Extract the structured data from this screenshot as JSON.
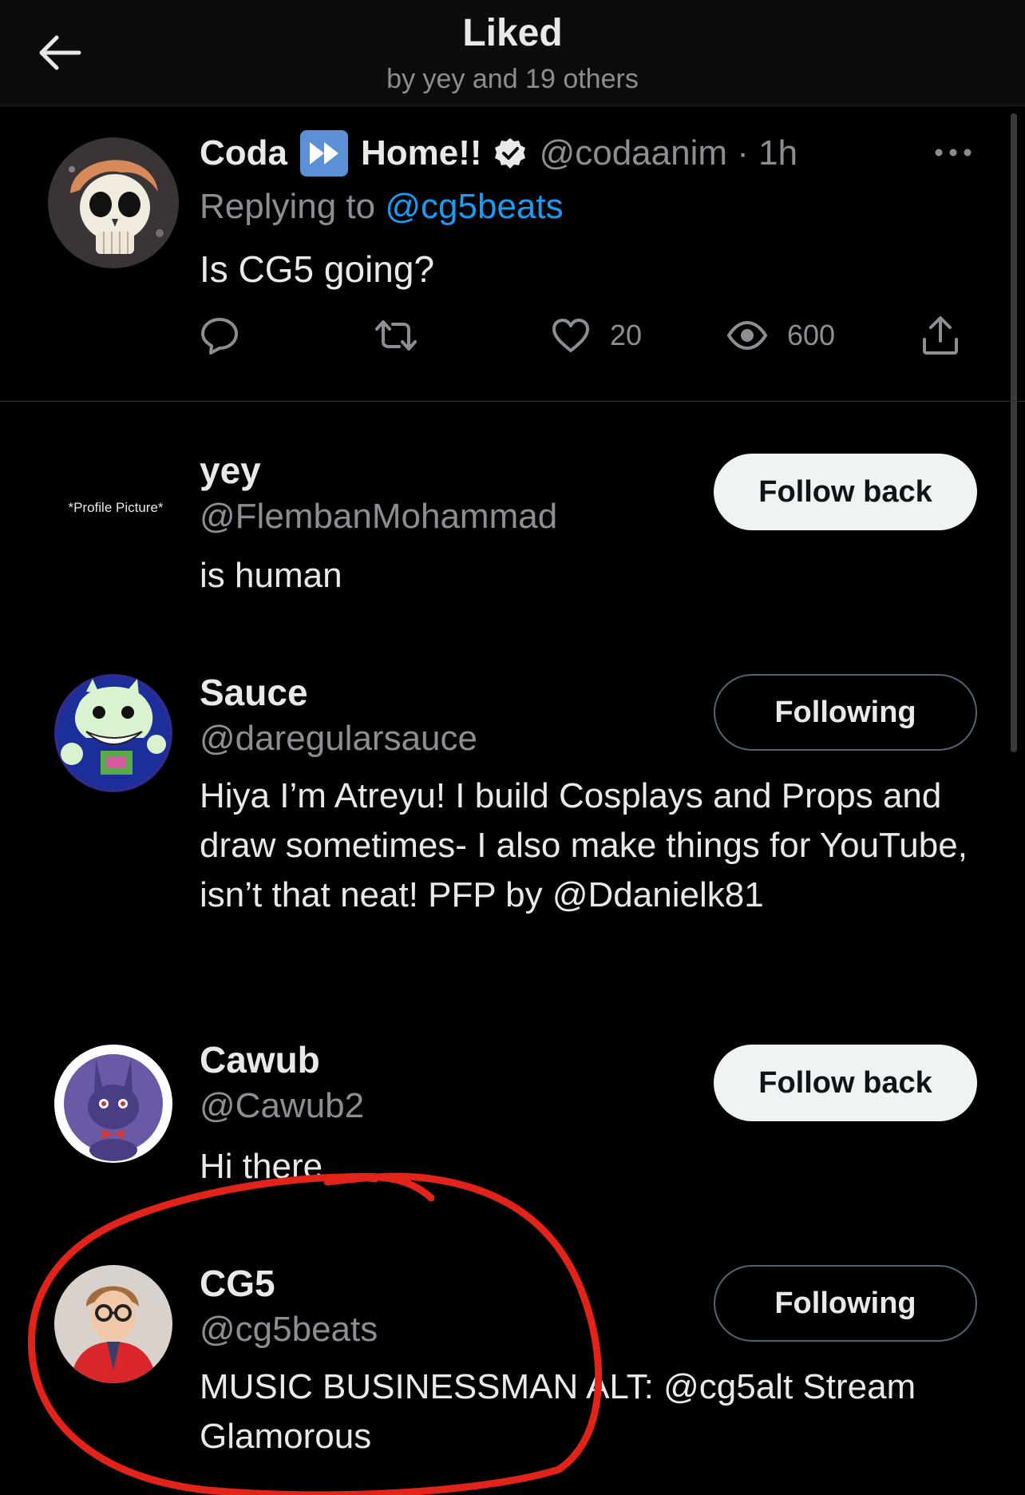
{
  "header": {
    "title": "Liked",
    "subtitle": "by yey and 19 others"
  },
  "tweet": {
    "name_part1": "Coda",
    "name_part2": "Home!!",
    "handle_time": "@codaanim · 1h",
    "replying_prefix": "Replying to",
    "replying_handle": "@cg5beats",
    "text": "Is CG5 going?",
    "likes": "20",
    "views": "600"
  },
  "users": [
    {
      "name": "yey",
      "handle": "@FlembanMohammad",
      "bio": "is human",
      "button": "Follow back",
      "avatar_text": "*Profile Picture*"
    },
    {
      "name": "Sauce",
      "handle": "@daregularsauce",
      "bio": "Hiya I’m Atreyu! I build Cosplays and Props and draw sometimes- I also make things for YouTube, isn’t that neat! PFP by @Ddanielk81",
      "button": "Following"
    },
    {
      "name": "Cawub",
      "handle": "@Cawub2",
      "bio": "Hi there",
      "button": "Follow back"
    },
    {
      "name": "CG5",
      "handle": "@cg5beats",
      "bio": "MUSIC BUSINESSMAN ALT: @cg5alt Stream Glamorous",
      "button": "Following"
    }
  ],
  "colors": {
    "background": "#000000",
    "link": "#1d9bf0",
    "secondary_text": "#8b8f94",
    "annotation": "#e2231a"
  }
}
